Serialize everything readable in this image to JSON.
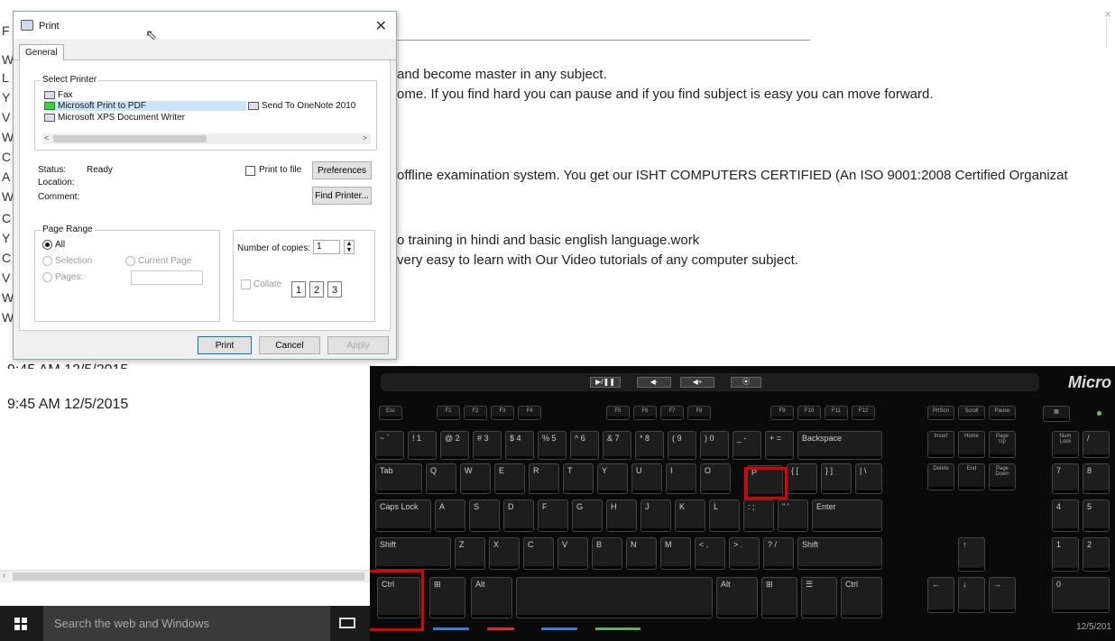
{
  "document": {
    "margin_chars": [
      "F",
      "W",
      "L",
      "Y",
      "V",
      "W",
      "C",
      "A",
      "W",
      "C",
      "Y",
      "C",
      "V",
      "W",
      "W"
    ],
    "lines": [
      "and become master in any subject.",
      "ome. If you find hard you can pause and if you find subject is easy you can move forward.",
      "offline examination system. You get our ISHT COMPUTERS CERTIFIED (An ISO 9001:2008 Certified Organizat",
      "o training in hindi and basic english language.work",
      "very easy to learn with Our Video tutorials of any computer subject."
    ],
    "timestamp_cut": "9:45 AM 12/5/2015",
    "timestamp": "9:45 AM 12/5/2015",
    "close_glyph": "×",
    "scroll_left": "‹"
  },
  "print_dialog": {
    "title": "Print",
    "close_glyph": "✕",
    "tab": "General",
    "select_printer": {
      "label": "Select Printer",
      "printers": [
        "Fax",
        "Microsoft Print to PDF",
        "Microsoft XPS Document Writer",
        "Send To OneNote 2010"
      ],
      "selected": "Microsoft Print to PDF",
      "scroll_left": "<",
      "scroll_right": ">"
    },
    "status_label": "Status:",
    "status_value": "Ready",
    "location_label": "Location:",
    "comment_label": "Comment:",
    "print_to_file": "Print to file",
    "preferences": "Preferences",
    "find_printer": "Find Printer...",
    "page_range": {
      "label": "Page Range",
      "all": "All",
      "selection": "Selection",
      "current_page": "Current Page",
      "pages": "Pages:"
    },
    "copies": {
      "label": "Number of copies:",
      "value": "1",
      "spin_up": "▲",
      "spin_down": "▼",
      "collate": "Collate"
    },
    "buttons": {
      "print": "Print",
      "cancel": "Cancel",
      "apply": "Apply"
    }
  },
  "keyboard": {
    "brand": "Micro",
    "media_keys": [
      "▶/❚❚",
      "◀-",
      "◀+",
      "⦿"
    ],
    "fn_keys": [
      "Esc",
      "F1",
      "F2",
      "F3",
      "F4",
      "F5",
      "F6",
      "F7",
      "F8",
      "F9",
      "F10",
      "F11",
      "F12",
      "PrtScn",
      "Scroll",
      "Pause"
    ],
    "number_row": [
      "~ `",
      "! 1",
      "@ 2",
      "# 3",
      "$ 4",
      "% 5",
      "^ 6",
      "& 7",
      "* 8",
      "( 9",
      ") 0",
      "_ -",
      "+ =",
      "Backspace"
    ],
    "q_row": [
      "Tab",
      "Q",
      "W",
      "E",
      "R",
      "T",
      "Y",
      "U",
      "I",
      "O",
      "P",
      "{ [",
      "} ]",
      "| \\"
    ],
    "a_row": [
      "Caps Lock",
      "A",
      "S",
      "D",
      "F",
      "G",
      "H",
      "J",
      "K",
      "L",
      ": ;",
      "\" '",
      "Enter"
    ],
    "z_row": [
      "Shift",
      "Z",
      "X",
      "C",
      "V",
      "B",
      "N",
      "M",
      "< ,",
      "> .",
      "? /",
      "Shift"
    ],
    "bottom_row": [
      "Ctrl",
      "Alt",
      "Alt",
      "Ctrl"
    ],
    "nav_keys": [
      "Insert",
      "Home",
      "Page Up",
      "Delete",
      "End",
      "Page Down"
    ],
    "numpad": [
      "Num Lock",
      "/",
      "7",
      "8",
      "4",
      "5",
      "1",
      "2",
      "0"
    ],
    "highlight_color": "#e00000"
  },
  "taskbar": {
    "search_placeholder": "Search the web and Windows",
    "clock": "12/5/201"
  }
}
